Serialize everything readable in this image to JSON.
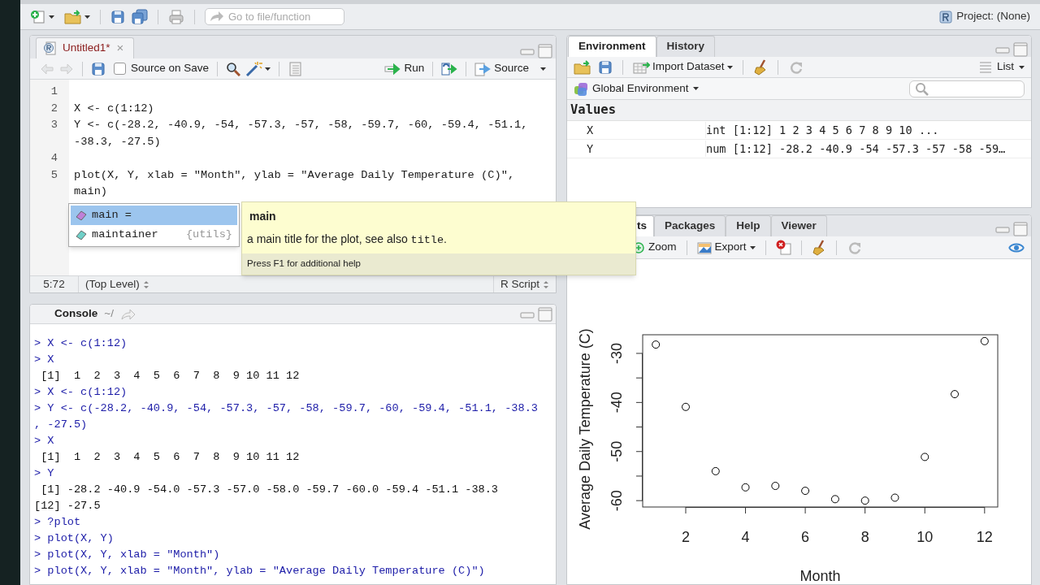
{
  "toolbar": {
    "goto_placeholder": "Go to file/function",
    "project": "Project: (None)"
  },
  "editor": {
    "tabs": [
      {
        "label": "Untitled1*",
        "selected": true,
        "close": "×"
      }
    ],
    "source_on_save": {
      "label": "Source on Save",
      "checked": false
    },
    "run_label": "Run",
    "source_label": "Source",
    "lines": [
      {
        "number": "1"
      },
      {
        "number": "2",
        "segments": [
          "X <- c(1:12)"
        ]
      },
      {
        "number": "3",
        "segments": [
          "Y <- c(-28.2, -40.9, -54, -57.3, -57, -58, -59.7, -60, -59.4, -51.1,",
          "-38.3, -27.5)"
        ]
      },
      {
        "number": "4"
      },
      {
        "number": "5",
        "segments": [
          "plot(X, Y, xlab = \"Month\", ylab = \"Average Daily Temperature (C)\",",
          "main)"
        ]
      }
    ],
    "status": {
      "position": "5:72",
      "scope": "(Top Level)",
      "file_type": "R Script"
    }
  },
  "completion": {
    "items": [
      {
        "label": "main =",
        "kind": "argument",
        "selected": true
      },
      {
        "label": "maintainer",
        "package": "{utils}",
        "kind": "function",
        "selected": false
      }
    ],
    "help": {
      "title": "main",
      "text": "a main title for the plot, see also ",
      "code": "title",
      "end": ".",
      "footer": "Press F1 for additional help"
    }
  },
  "console": {
    "title": "Console",
    "path": "~/",
    "lines": [
      {
        "kind": "input",
        "text": "> X <- c(1:12)"
      },
      {
        "kind": "input",
        "text": "> X"
      },
      {
        "kind": "output",
        "text": " [1]  1  2  3  4  5  6  7  8  9 10 11 12"
      },
      {
        "kind": "input",
        "text": "> X <- c(1:12)"
      },
      {
        "kind": "input",
        "text": "> Y <- c(-28.2, -40.9, -54, -57.3, -57, -58, -59.7, -60, -59.4, -51.1, -38.3"
      },
      {
        "kind": "input",
        "text": ", -27.5)"
      },
      {
        "kind": "input",
        "text": "> X"
      },
      {
        "kind": "output",
        "text": " [1]  1  2  3  4  5  6  7  8  9 10 11 12"
      },
      {
        "kind": "input",
        "text": "> Y"
      },
      {
        "kind": "output",
        "text": " [1] -28.2 -40.9 -54.0 -57.3 -57.0 -58.0 -59.7 -60.0 -59.4 -51.1 -38.3"
      },
      {
        "kind": "output",
        "text": "[12] -27.5"
      },
      {
        "kind": "input",
        "text": "> ?plot"
      },
      {
        "kind": "input",
        "text": "> plot(X, Y)"
      },
      {
        "kind": "input",
        "text": "> plot(X, Y, xlab = \"Month\")"
      },
      {
        "kind": "input",
        "text": "> plot(X, Y, xlab = \"Month\", ylab = \"Average Daily Temperature (C)\")"
      }
    ]
  },
  "environment": {
    "tabs": [
      {
        "label": "Environment",
        "selected": true
      },
      {
        "label": "History",
        "selected": false
      }
    ],
    "import_label": "Import Dataset",
    "view_label": "List",
    "scope": "Global Environment",
    "section": "Values",
    "rows": [
      {
        "name": "X",
        "value": "int [1:12] 1 2 3 4 5 6 7 8 9 10 ..."
      },
      {
        "name": "Y",
        "value": "num [1:12] -28.2 -40.9 -54 -57.3 -57 -58 -59…"
      }
    ]
  },
  "plots": {
    "tabs": [
      {
        "label": "ts",
        "selected": true
      },
      {
        "label": "Packages",
        "selected": false
      },
      {
        "label": "Help",
        "selected": false
      },
      {
        "label": "Viewer",
        "selected": false
      }
    ],
    "zoom_label": "Zoom",
    "export_label": "Export",
    "chart_data": {
      "type": "scatter",
      "xlabel": "Month",
      "ylabel": "Average Daily Temperature (C)",
      "x": [
        1,
        2,
        3,
        4,
        5,
        6,
        7,
        8,
        9,
        10,
        11,
        12
      ],
      "series": [
        {
          "color": "#000000",
          "values": [
            -28.2,
            -40.9,
            -54,
            -57.3,
            -57,
            -58,
            -59.7,
            -60,
            -59.4,
            -51.1,
            -38.3,
            -27.5
          ]
        }
      ],
      "xlim": [
        0.56,
        12.44
      ],
      "ylim": [
        -61.3,
        -26.2
      ],
      "xticks": [
        2,
        4,
        6,
        8,
        10,
        12
      ],
      "yticks": [
        -60,
        -50,
        -40,
        -30
      ]
    }
  }
}
